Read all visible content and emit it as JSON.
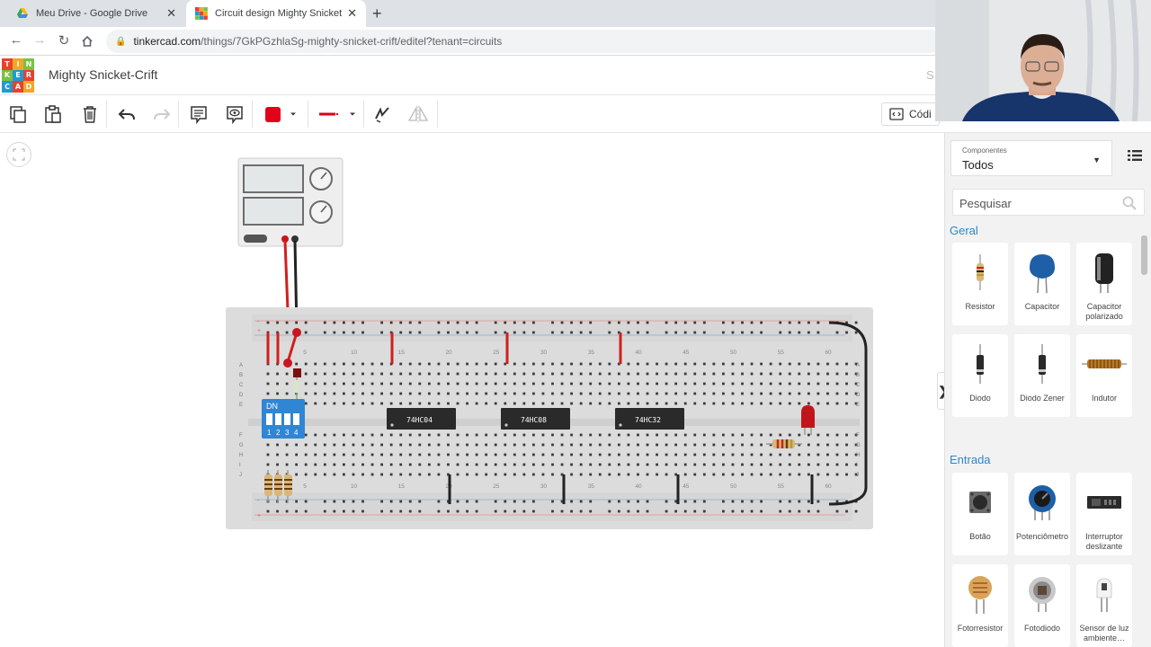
{
  "browser": {
    "tabs": [
      {
        "title": "Meu Drive - Google Drive",
        "active": false
      },
      {
        "title": "Circuit design Mighty Snicket-Crift",
        "active": true
      }
    ],
    "url_domain": "tinkercad.com",
    "url_path": "/things/7GkPGzhlaSg-mighty-snicket-crift/editel?tenant=circuits"
  },
  "app": {
    "logo_letters": [
      "T",
      "I",
      "N",
      "K",
      "E",
      "R",
      "C",
      "A",
      "D"
    ],
    "design_name": "Mighty Snicket-Crift",
    "header_right_text": "S",
    "code_button_label": "Códi"
  },
  "toolbar": {
    "fill_color": "#e3001b",
    "wire_color": "#d9001b",
    "icons": [
      "copy-icon",
      "paste-icon",
      "delete-icon",
      "undo-icon",
      "redo-icon",
      "notes-icon",
      "notes-visibility-icon",
      "color-swatch-icon",
      "wire-type-icon",
      "rotate-icon",
      "flip-icon"
    ]
  },
  "circuit": {
    "chips": [
      "74HC04",
      "74HC08",
      "74HC32"
    ],
    "dip_switch": {
      "label": "DN",
      "numbers": [
        "1",
        "2",
        "3",
        "4"
      ]
    },
    "column_numbers": [
      "1",
      "5",
      "10",
      "15",
      "20",
      "25",
      "30",
      "35",
      "40",
      "45",
      "50",
      "55",
      "60"
    ],
    "row_letters_top": [
      "A",
      "B",
      "C",
      "D",
      "E"
    ],
    "row_letters_bottom": [
      "F",
      "G",
      "H",
      "I",
      "J"
    ],
    "rail_plus": "+",
    "rail_minus": "-",
    "led_color": "#c0161b",
    "wire_positive": "#d11f1f",
    "wire_negative": "#222222"
  },
  "panel": {
    "components_label": "Componentes",
    "category_value": "Todos",
    "search_placeholder": "Pesquisar",
    "sections": [
      {
        "title": "Geral",
        "items": [
          {
            "label": "Resistor",
            "icon": "resistor-icon"
          },
          {
            "label": "Capacitor",
            "icon": "capacitor-icon"
          },
          {
            "label": "Capacitor polarizado",
            "icon": "polarized-capacitor-icon"
          },
          {
            "label": "Diodo",
            "icon": "diode-icon"
          },
          {
            "label": "Diodo Zener",
            "icon": "zener-diode-icon"
          },
          {
            "label": "Indutor",
            "icon": "inductor-icon"
          }
        ]
      },
      {
        "title": "Entrada",
        "items": [
          {
            "label": "Botão",
            "icon": "pushbutton-icon"
          },
          {
            "label": "Potenciômetro",
            "icon": "potentiometer-icon"
          },
          {
            "label": "Interruptor deslizante",
            "icon": "slide-switch-icon"
          },
          {
            "label": "Fotorresistor",
            "icon": "photoresistor-icon"
          },
          {
            "label": "Fotodiodo",
            "icon": "photodiode-icon"
          },
          {
            "label": "Sensor de luz ambiente…",
            "icon": "ambient-light-sensor-icon"
          }
        ]
      }
    ]
  },
  "accent_color": "#2f86c9"
}
